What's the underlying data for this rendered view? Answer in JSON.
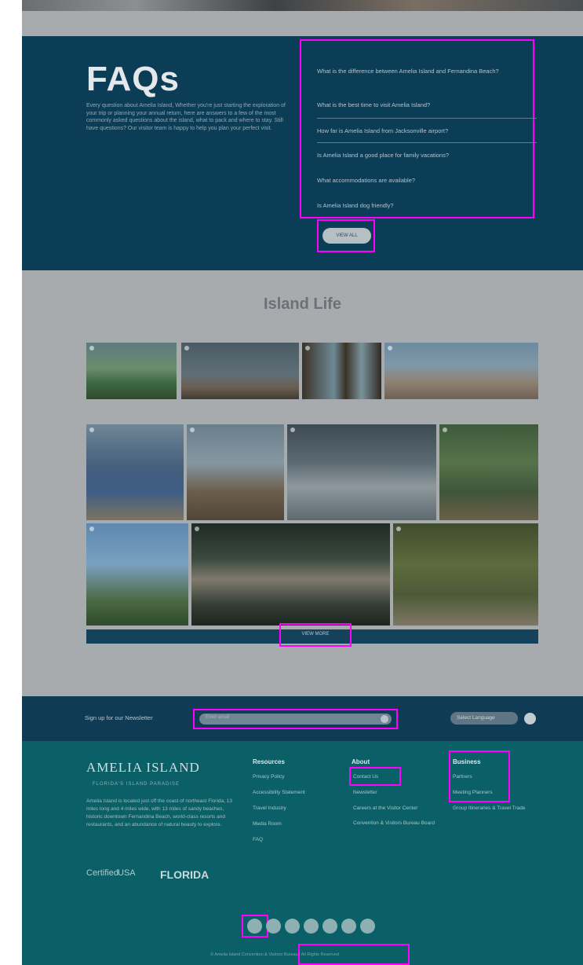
{
  "faq": {
    "title": "FAQs",
    "intro": "Every question about Amelia Island, Whether you're just starting the exploration of your trip or planning your annual return, here are answers to a few of the most commonly asked questions about the island, what to pack and where to stay. Still have questions? Our visitor team is happy to help you plan your perfect visit.",
    "questions": [
      "What is the difference between Amelia Island and Fernandina Beach?",
      "What is the best time to visit Amelia Island?",
      "How far is Amelia Island from Jacksonville airport?",
      "Is Amelia Island a good place for family vacations?",
      "What accommodations are available?",
      "Is Amelia Island dog friendly?"
    ],
    "button": "VIEW ALL"
  },
  "island_life": {
    "title": "Island Life",
    "button": "VIEW MORE"
  },
  "newsletter": {
    "label": "Sign up for our Newsletter",
    "placeholder": "Enter email",
    "language": "Select Language"
  },
  "footer": {
    "logo": "AMELIA ISLAND",
    "tagline": "FLORIDA'S ISLAND PARADISE",
    "about_text": "Amelia Island is located just off the coast of northeast Florida, 13 miles long and 4 miles wide, with 13 miles of sandy beaches, historic downtown Fernandina Beach, world-class resorts and restaurants, and an abundance of natural beauty to explore.",
    "partners": [
      "Certified",
      "USA"
    ],
    "florida": "FLORIDA",
    "columns": [
      {
        "heading": "Resources",
        "links": [
          "Privacy Policy",
          "Accessibility Statement",
          "Travel Industry",
          "Media Room",
          "FAQ"
        ]
      },
      {
        "heading": "About",
        "links": [
          "Contact Us",
          "Newsletter",
          "Careers at the Visitor Center",
          "Convention & Visitors Bureau Board"
        ]
      },
      {
        "heading": "Business",
        "links": [
          "Partners",
          "Meeting Planners",
          "Group Itineraries & Travel Trade"
        ]
      }
    ],
    "copyright": "© Amelia Island Convention & Visitors Bureau | All Rights Reserved"
  },
  "colors": {
    "faq_bg": "#0b3d57",
    "page_bg": "#a8abad",
    "newsletter_bg": "#103b54",
    "footer_bg": "#0b6068",
    "highlight": "#ff00ff"
  },
  "social_icons": [
    "facebook-icon",
    "twitter-icon",
    "instagram-icon",
    "youtube-icon",
    "pinterest-icon",
    "tripadvisor-icon",
    "tiktok-icon"
  ]
}
